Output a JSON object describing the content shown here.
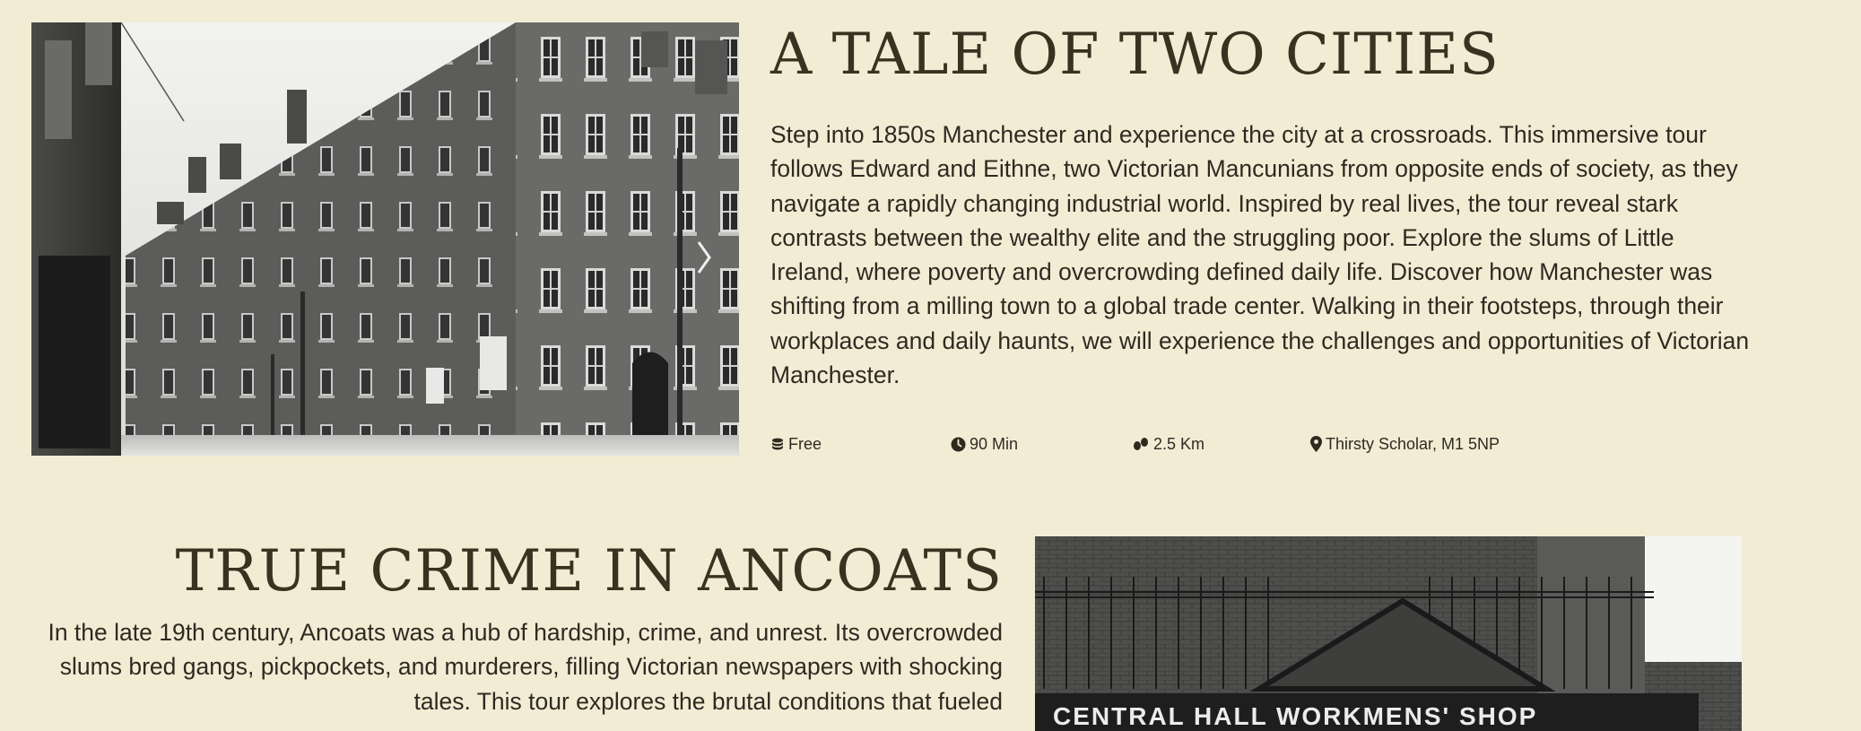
{
  "tours": [
    {
      "title": "A TALE OF TWO CITIES",
      "description": "Step into 1850s Manchester and experience the city at a crossroads. This immersive tour follows Edward and Eithne, two Victorian Mancunians from opposite ends of society, as they navigate a rapidly changing industrial world. Inspired by real lives, the tour reveal stark contrasts between the wealthy elite and the struggling poor. Explore the slums of Little Ireland, where poverty and overcrowding defined daily life. Discover how Manchester was shifting from a milling town to a global trade center. Walking in their footsteps, through their workplaces and daily haunts, we will experience the challenges and opportunities of Victorian Manchester.",
      "price": "Free",
      "duration": "90 Min",
      "distance": "2.5 Km",
      "location": "Thirsty Scholar, M1 5NP",
      "icons": [
        "coins-icon",
        "clock-icon",
        "footsteps-icon",
        "map-pin-icon"
      ]
    },
    {
      "title": "TRUE CRIME IN ANCOATS",
      "description": "In the late 19th century, Ancoats was a hub of hardship, crime, and unrest. Its overcrowded slums bred gangs, pickpockets, and murderers, filling Victorian newspapers with shocking tales. This tour explores the brutal conditions that fueled",
      "photo_sign": "CENTRAL HALL WORKMENS' SHOP"
    }
  ],
  "colors": {
    "background": "#f3ecd5",
    "heading": "#3a3220",
    "text": "#2f2a20"
  }
}
